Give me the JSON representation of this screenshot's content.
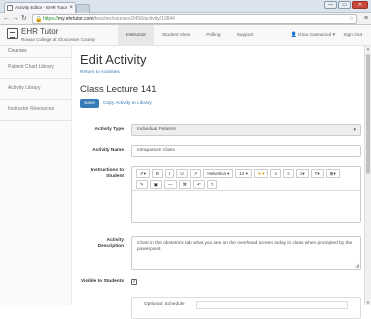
{
  "browser": {
    "tab_title": "Activity Editor - EHR Tutor",
    "url_protocol": "https://",
    "url_host": "my.ehrtutor.com",
    "url_path": "/teacher/courses/2456/activity/10844",
    "win_min": "—",
    "win_max": "▭",
    "win_close": "✕"
  },
  "header": {
    "brand": "EHR Tutor",
    "college": "Rowan College at Gloucester County",
    "nav": [
      "Instructor",
      "Student View",
      "Polling",
      "Support"
    ],
    "user": "Gina Gatewood",
    "signout": "Sign Out"
  },
  "sidebar": {
    "items": [
      "Courses",
      "Patient Chart Library",
      "Activity Library",
      "Instructor Resources"
    ]
  },
  "main": {
    "title": "Edit Activity",
    "return_link": "Return to Activities",
    "subtitle": "Class Lecture 141",
    "save_label": "Save",
    "copy_link": "Copy Activity to Library",
    "fields": {
      "activity_type_label": "Activity Type",
      "activity_type_value": "Individual Patients",
      "activity_name_label": "Activity Name",
      "activity_name_value": "Intrapartum Class",
      "instructions_label": "Instructions to Student",
      "description_label": "Activity Description",
      "description_value": "Chart in the obstetrics tab what you see on the overhead screen today in class when prompted by the powerpoint.",
      "visible_label": "Visible to Students",
      "optional_schedule_label": "Optional: Schedule"
    },
    "toolbar_row1": [
      "✐▾",
      "B",
      "I",
      "U",
      "↗",
      "Helvetica ▾",
      "14 ▾",
      "A ▾",
      "≡",
      "≡",
      "≡▾",
      "T▾",
      "⊞▾"
    ],
    "toolbar_row2": [
      "✎",
      "▣",
      "—",
      "⌘",
      "↶",
      "?"
    ]
  }
}
